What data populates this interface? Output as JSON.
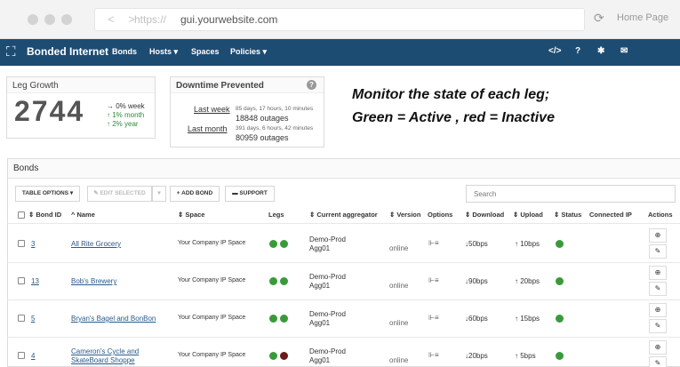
{
  "browser": {
    "nav_arrows": "< >",
    "url_protocol": "https://",
    "url_host": "gui.yourwebsite.com",
    "home_label": "Home Page"
  },
  "navbar": {
    "brand": "Bonded Internet",
    "items": [
      "Bonds",
      "Hosts ▾",
      "Spaces",
      "Policies ▾"
    ],
    "icons": [
      "code-icon",
      "help-icon",
      "gear-icon",
      "mail-icon"
    ],
    "icon_glyphs": [
      "</>",
      "?",
      "✱",
      "✉"
    ]
  },
  "leg_growth": {
    "title": "Leg Growth",
    "value": "2744",
    "stats": [
      "→ 0% week",
      "↑ 1% month",
      "↑ 2% year"
    ]
  },
  "downtime": {
    "title": "Downtime Prevented",
    "rows": [
      {
        "label": "Last week",
        "duration": "85 days, 17 hours, 10 minutes",
        "outages": "18848 outages"
      },
      {
        "label": "Last month",
        "duration": "391 days, 6 hours, 42 minutes",
        "outages": "80959 outages"
      }
    ]
  },
  "caption": {
    "line1": "Monitor the state of each leg;",
    "line2": "Green = Active , red = Inactive"
  },
  "bonds": {
    "title": "Bonds",
    "toolbar": {
      "table_options": "TABLE OPTIONS ▾",
      "edit_selected": "✎ EDIT SELECTED",
      "dropdown": "▾",
      "add_bond": "+ ADD BOND",
      "support": "▬ SUPPORT"
    },
    "search_placeholder": "Search",
    "columns": [
      "⇕ Bond ID",
      "^ Name",
      "⇕ Space",
      "Legs",
      "⇕ Current aggregator",
      "⇕ Version",
      "Options",
      "⇕ Download",
      "⇕ Upload",
      "⇕ Status",
      "Connected IP",
      "Actions"
    ],
    "rows": [
      {
        "id": "3",
        "name": "All Rite Grocery",
        "name2": "",
        "space": "Your Company IP Space",
        "legs": [
          "#3a9a3a",
          "#3a9a3a"
        ],
        "agg1": "Demo-Prod",
        "agg2": "Agg01",
        "version": "online",
        "download": "↓50bps",
        "upload": "↑  10bps",
        "status": "#3a9a3a"
      },
      {
        "id": "13",
        "name": "Bob's Brewery",
        "name2": "",
        "space": "Your Company IP Space",
        "legs": [
          "#3a9a3a",
          "#3a9a3a"
        ],
        "agg1": "Demo-Prod",
        "agg2": "Agg01",
        "version": "online",
        "download": "↓90bps",
        "upload": "↑  20bps",
        "status": "#3a9a3a"
      },
      {
        "id": "5",
        "name": "Bryan's Bagel and BonBon",
        "name2": "",
        "space": "Your Company IP Space",
        "legs": [
          "#3a9a3a",
          "#3a9a3a"
        ],
        "agg1": "Demo-Prod",
        "agg2": "Agg01",
        "version": "online",
        "download": "↓60bps",
        "upload": "↑  15bps",
        "status": "#3a9a3a"
      },
      {
        "id": "4",
        "name": "Cameron's Cycle and",
        "name2": "SkateBoard Shoppe",
        "space": "Your Company IP Space",
        "legs": [
          "#3a9a3a",
          "#6b1a1a"
        ],
        "agg1": "Demo-Prod",
        "agg2": "Agg01",
        "version": "online",
        "download": "↓20bps",
        "upload": "↑   5bps",
        "status": "#3a9a3a"
      }
    ],
    "options_icon": "⊩≡",
    "action_icons": [
      "⊕",
      "✎"
    ]
  }
}
